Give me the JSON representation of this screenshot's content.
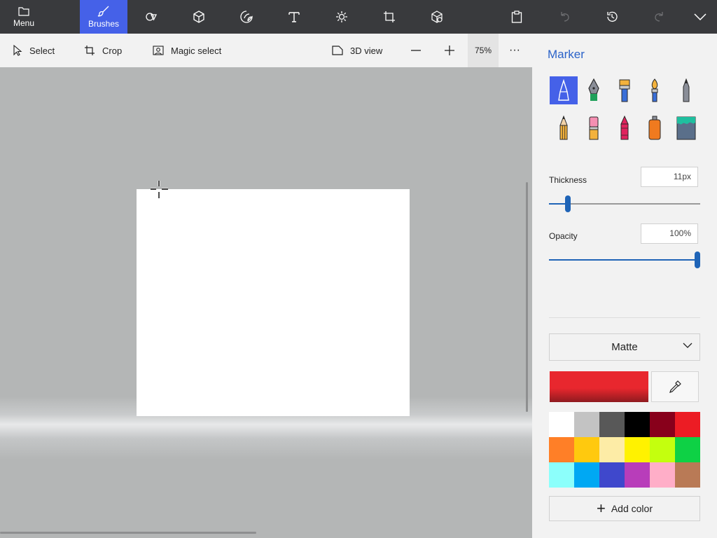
{
  "colors": {
    "topbar": "#393a3d",
    "accent": "#4561e8",
    "panel": "#f2f2f2",
    "slider": "#1f64b7",
    "title": "#2b63c9"
  },
  "topbar": {
    "menu_label": "Menu",
    "brushes_label": "Brushes",
    "tools": [
      "2d-shapes-icon",
      "3d-shapes-icon",
      "stickers-icon",
      "text-icon",
      "effects-icon",
      "canvas-icon",
      "3d-library-icon",
      "paste-icon",
      "undo-icon",
      "history-icon",
      "redo-icon",
      "expand-icon"
    ]
  },
  "toolbar": {
    "select_label": "Select",
    "crop_label": "Crop",
    "magic_select_label": "Magic select",
    "view3d_label": "3D view",
    "zoom_value": "75%",
    "more_label": "···"
  },
  "panel": {
    "title": "Marker",
    "brushes": [
      "marker",
      "calligraphy-pen",
      "oil-brush",
      "watercolor",
      "pixel-pen",
      "pencil",
      "eraser",
      "crayon",
      "spray-can",
      "fill"
    ],
    "selected_brush": "marker",
    "thickness_label": "Thickness",
    "thickness_value": "11px",
    "thickness_fraction": 0.11,
    "opacity_label": "Opacity",
    "opacity_value": "100%",
    "opacity_fraction": 1.0,
    "finish": "Matte",
    "current_color": "#e8272e",
    "palette": [
      "#ffffff",
      "#c3c3c3",
      "#585858",
      "#000000",
      "#88001b",
      "#ec1c24",
      "#ff7f27",
      "#ffc90e",
      "#fdeca6",
      "#fff200",
      "#c4ff0e",
      "#0ed145",
      "#8cfffb",
      "#00a8f3",
      "#3f48cc",
      "#b83dba",
      "#ffaec8",
      "#b97a56"
    ],
    "add_color_label": "Add color"
  }
}
